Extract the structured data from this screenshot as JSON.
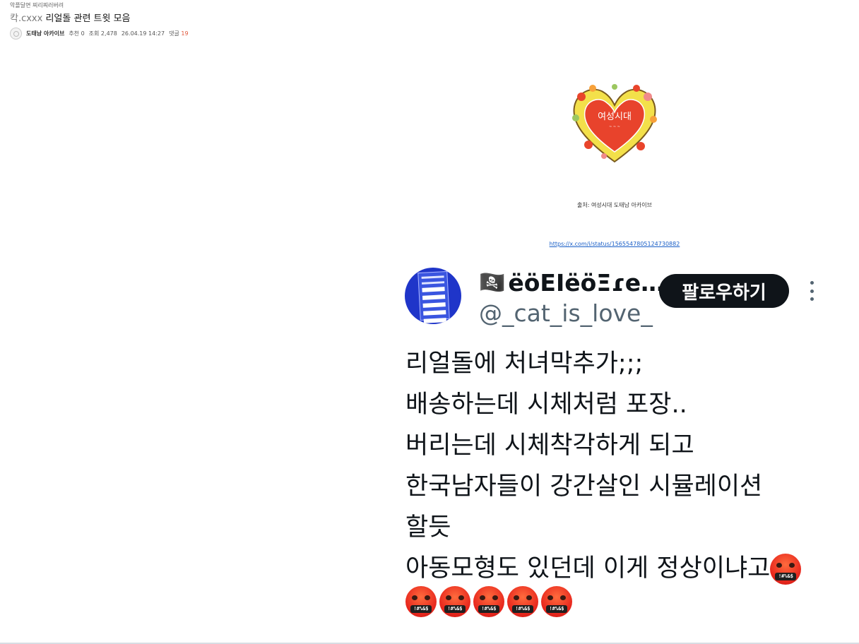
{
  "post": {
    "category": "악플달면 찌리찌러버려",
    "title_prefix": "칵.cxxx",
    "title": "리얼돌 관련 트윗 모음",
    "author": "도태남 아카이브",
    "recommend": "추천 0",
    "views": "조회 2,478",
    "datetime": "26.04.19 14:27",
    "comments_label": "댓글",
    "comments_count": "19"
  },
  "image_logo_text": "여성시대",
  "source_caption": "출처: 여성시대 도태남 아카이브",
  "link": "https://x.com/i/status/1565547805124730882",
  "tweet": {
    "name": "ëöEIëöΞɾe…",
    "name_flag": "🏴‍☠️",
    "handle": "@_cat_is_love_",
    "follow_label": "팔로우하기",
    "lines": [
      "리얼돌에 처녀막추가;;;",
      "배송하는데 시체처럼 포장..",
      "버리는데 시체착각하게 되고",
      "한국남자들이 강간살인 시뮬레이션",
      "할듯",
      "아동모형도 있던데 이게 정상이냐고"
    ],
    "emoji_name": "face-with-symbols-on-mouth",
    "emoji_mouth": "!#%&$",
    "emoji_count_inline": 1,
    "emoji_count_row": 5
  },
  "colors": {
    "link": "#1a5fc7",
    "comment_count": "#e0573b",
    "follow_button": "#0f1419",
    "handle": "#536471",
    "avatar_bg": "#1f35c9"
  }
}
